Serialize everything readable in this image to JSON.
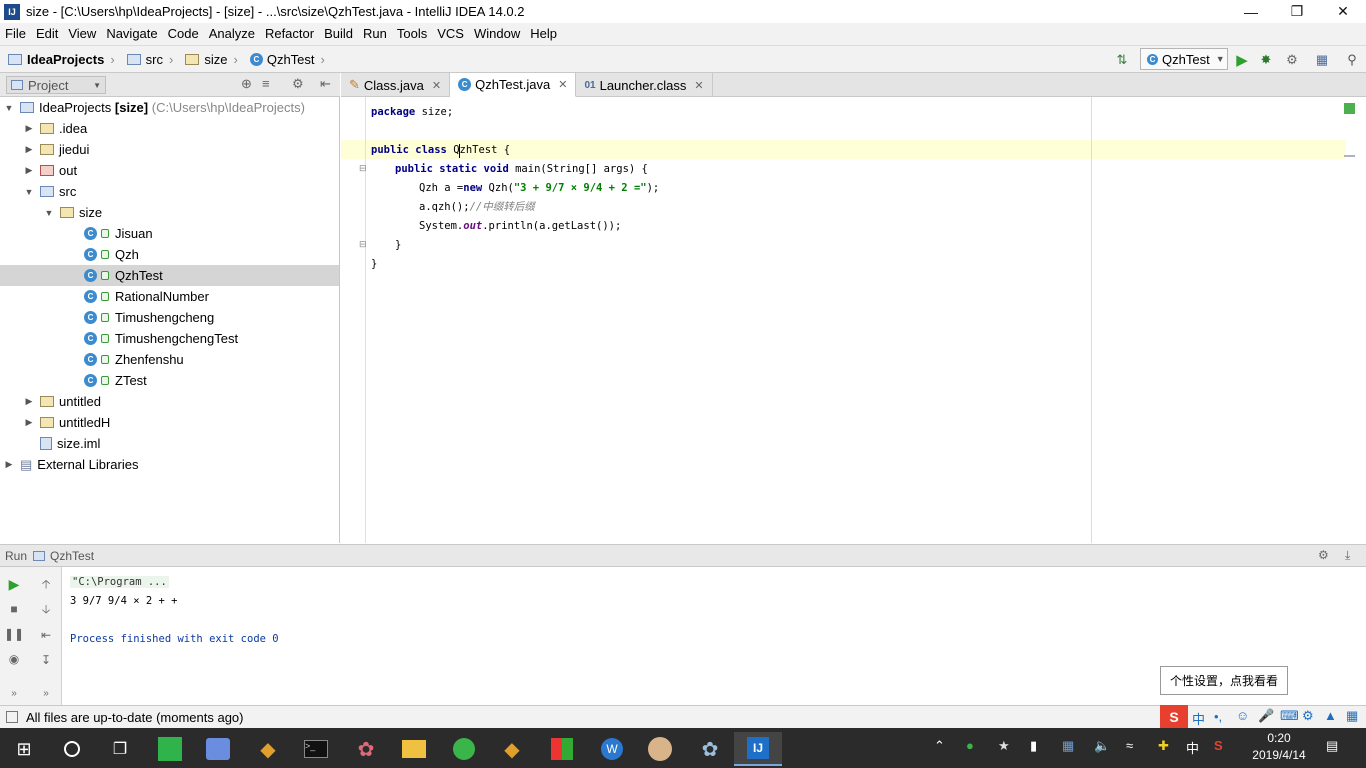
{
  "window": {
    "title": "size - [C:\\Users\\hp\\IdeaProjects] - [size] - ...\\src\\size\\QzhTest.java - IntelliJ IDEA 14.0.2",
    "logo": "IJ"
  },
  "menu": {
    "file": "File",
    "edit": "Edit",
    "view": "View",
    "navigate": "Navigate",
    "code": "Code",
    "analyze": "Analyze",
    "refactor": "Refactor",
    "build": "Build",
    "run": "Run",
    "tools": "Tools",
    "vcs": "VCS",
    "window": "Window",
    "help": "Help"
  },
  "breadcrumb": [
    "IdeaProjects",
    "src",
    "size",
    "QzhTest"
  ],
  "toolbar": {
    "run_config": "QzhTest"
  },
  "project_panel": {
    "title": "Project"
  },
  "tree": [
    {
      "label": "IdeaProjects",
      "bold": "[size]",
      "path": "(C:\\Users\\hp\\IdeaProjects)"
    },
    {
      "label": ".idea"
    },
    {
      "label": "jiedui"
    },
    {
      "label": "out"
    },
    {
      "label": "src"
    },
    {
      "label": "size"
    },
    {
      "label": "Jisuan"
    },
    {
      "label": "Qzh"
    },
    {
      "label": "QzhTest"
    },
    {
      "label": "RationalNumber"
    },
    {
      "label": "Timushengcheng"
    },
    {
      "label": "TimushengchengTest"
    },
    {
      "label": "Zhenfenshu"
    },
    {
      "label": "ZTest"
    },
    {
      "label": "untitled"
    },
    {
      "label": "untitledH"
    },
    {
      "label": "size.iml"
    },
    {
      "label": "External Libraries"
    }
  ],
  "tabs": [
    {
      "label": "Class.java"
    },
    {
      "label": "QzhTest.java"
    },
    {
      "label": "Launcher.class"
    }
  ],
  "code": {
    "l1a": "package",
    "l1b": " size;",
    "l3a": "public class ",
    "l3b": "QzhTest {",
    "l4a": "public static void ",
    "l4b": "main(String[] args) {",
    "l5a": "Qzh a =",
    "l5b": "new",
    "l5c": " Qzh(",
    "l5d": "\"3 + 9/7 × 9/4 + 2 =\"",
    "l5e": ");",
    "l6a": "a.qzh();",
    "l6b": "//中缀转后缀",
    "l7a": "System.",
    "l7b": "out",
    "l7c": ".println(a.getLast());",
    "l8": "}",
    "l9": "}"
  },
  "run_panel": {
    "label": "Run",
    "config": "QzhTest"
  },
  "console": {
    "cmd": "\"C:\\Program ...",
    "output": "3 9/7 9/4 × 2 + +",
    "exit": "Process finished with exit code 0"
  },
  "status": {
    "text": "All files are up-to-date (moments ago)"
  },
  "tooltip": {
    "text": "个性设置，点我看看"
  },
  "taskbar": {
    "time": "0:20",
    "date": "2019/4/14",
    "ime": "中"
  }
}
